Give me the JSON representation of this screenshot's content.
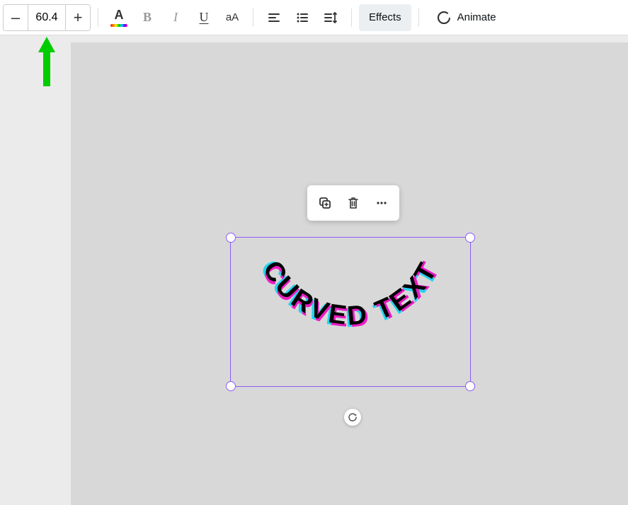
{
  "toolbar": {
    "size_value": "60.4",
    "minus_label": "–",
    "plus_label": "+",
    "color_glyph": "A",
    "bold_glyph": "B",
    "italic_glyph": "I",
    "underline_glyph": "U",
    "case_glyph": "aA",
    "effects_label": "Effects",
    "animate_label": "Animate"
  },
  "canvas": {
    "selected_text": "CURVED TEXT"
  },
  "colors": {
    "selection": "#8b5cf6",
    "arrow": "#00cc00",
    "text_main": "#000000",
    "text_cyan": "#22d3ee",
    "text_magenta": "#ec1bc4"
  }
}
